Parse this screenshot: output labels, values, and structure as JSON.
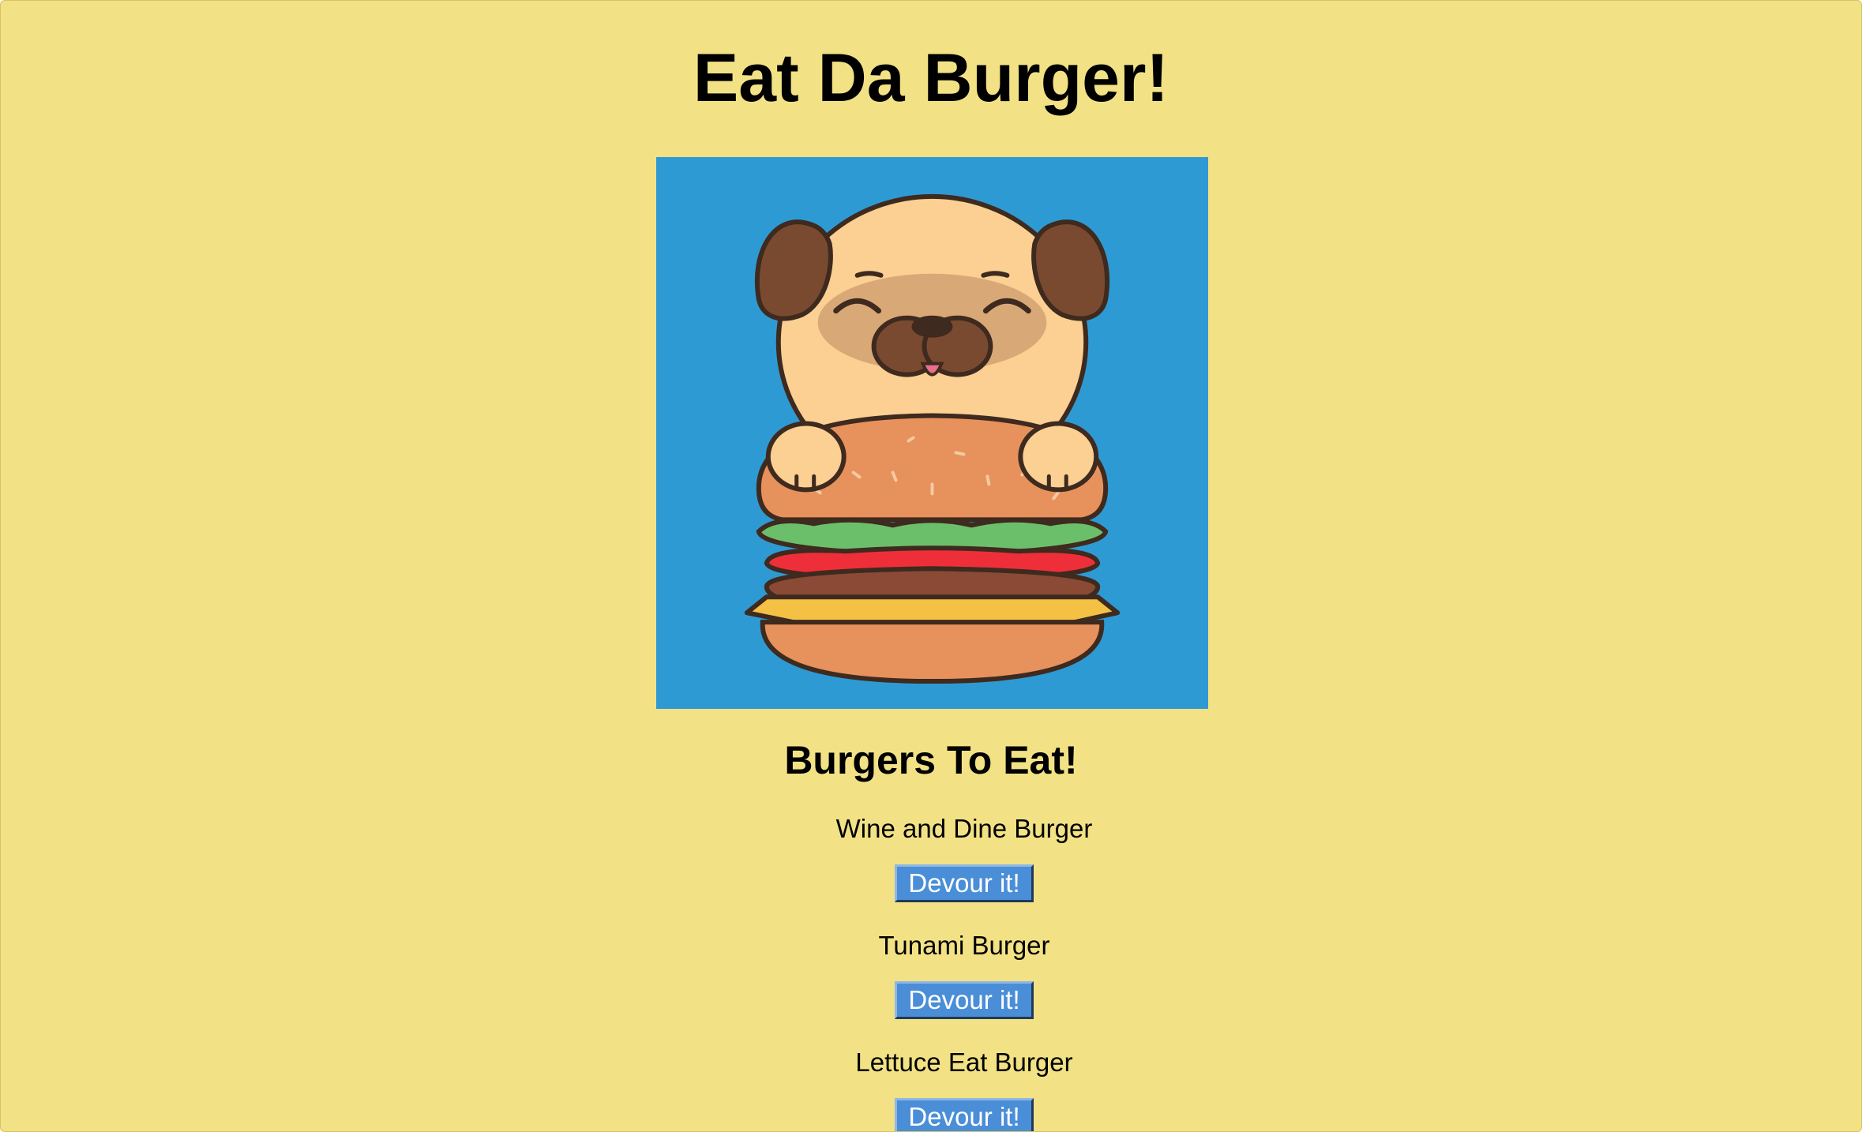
{
  "page": {
    "title": "Eat Da Burger!",
    "background_color": "#f2e285"
  },
  "hero_image": {
    "subject": "cartoon pug holding a burger",
    "background_color": "#2e9ad3"
  },
  "section": {
    "title": "Burgers To Eat!"
  },
  "burgers": [
    {
      "name": "Wine and Dine Burger",
      "button_label": "Devour it!"
    },
    {
      "name": "Tunami Burger",
      "button_label": "Devour it!"
    },
    {
      "name": "Lettuce Eat Burger",
      "button_label": "Devour it!"
    }
  ],
  "button_color": "#4a8ed8"
}
